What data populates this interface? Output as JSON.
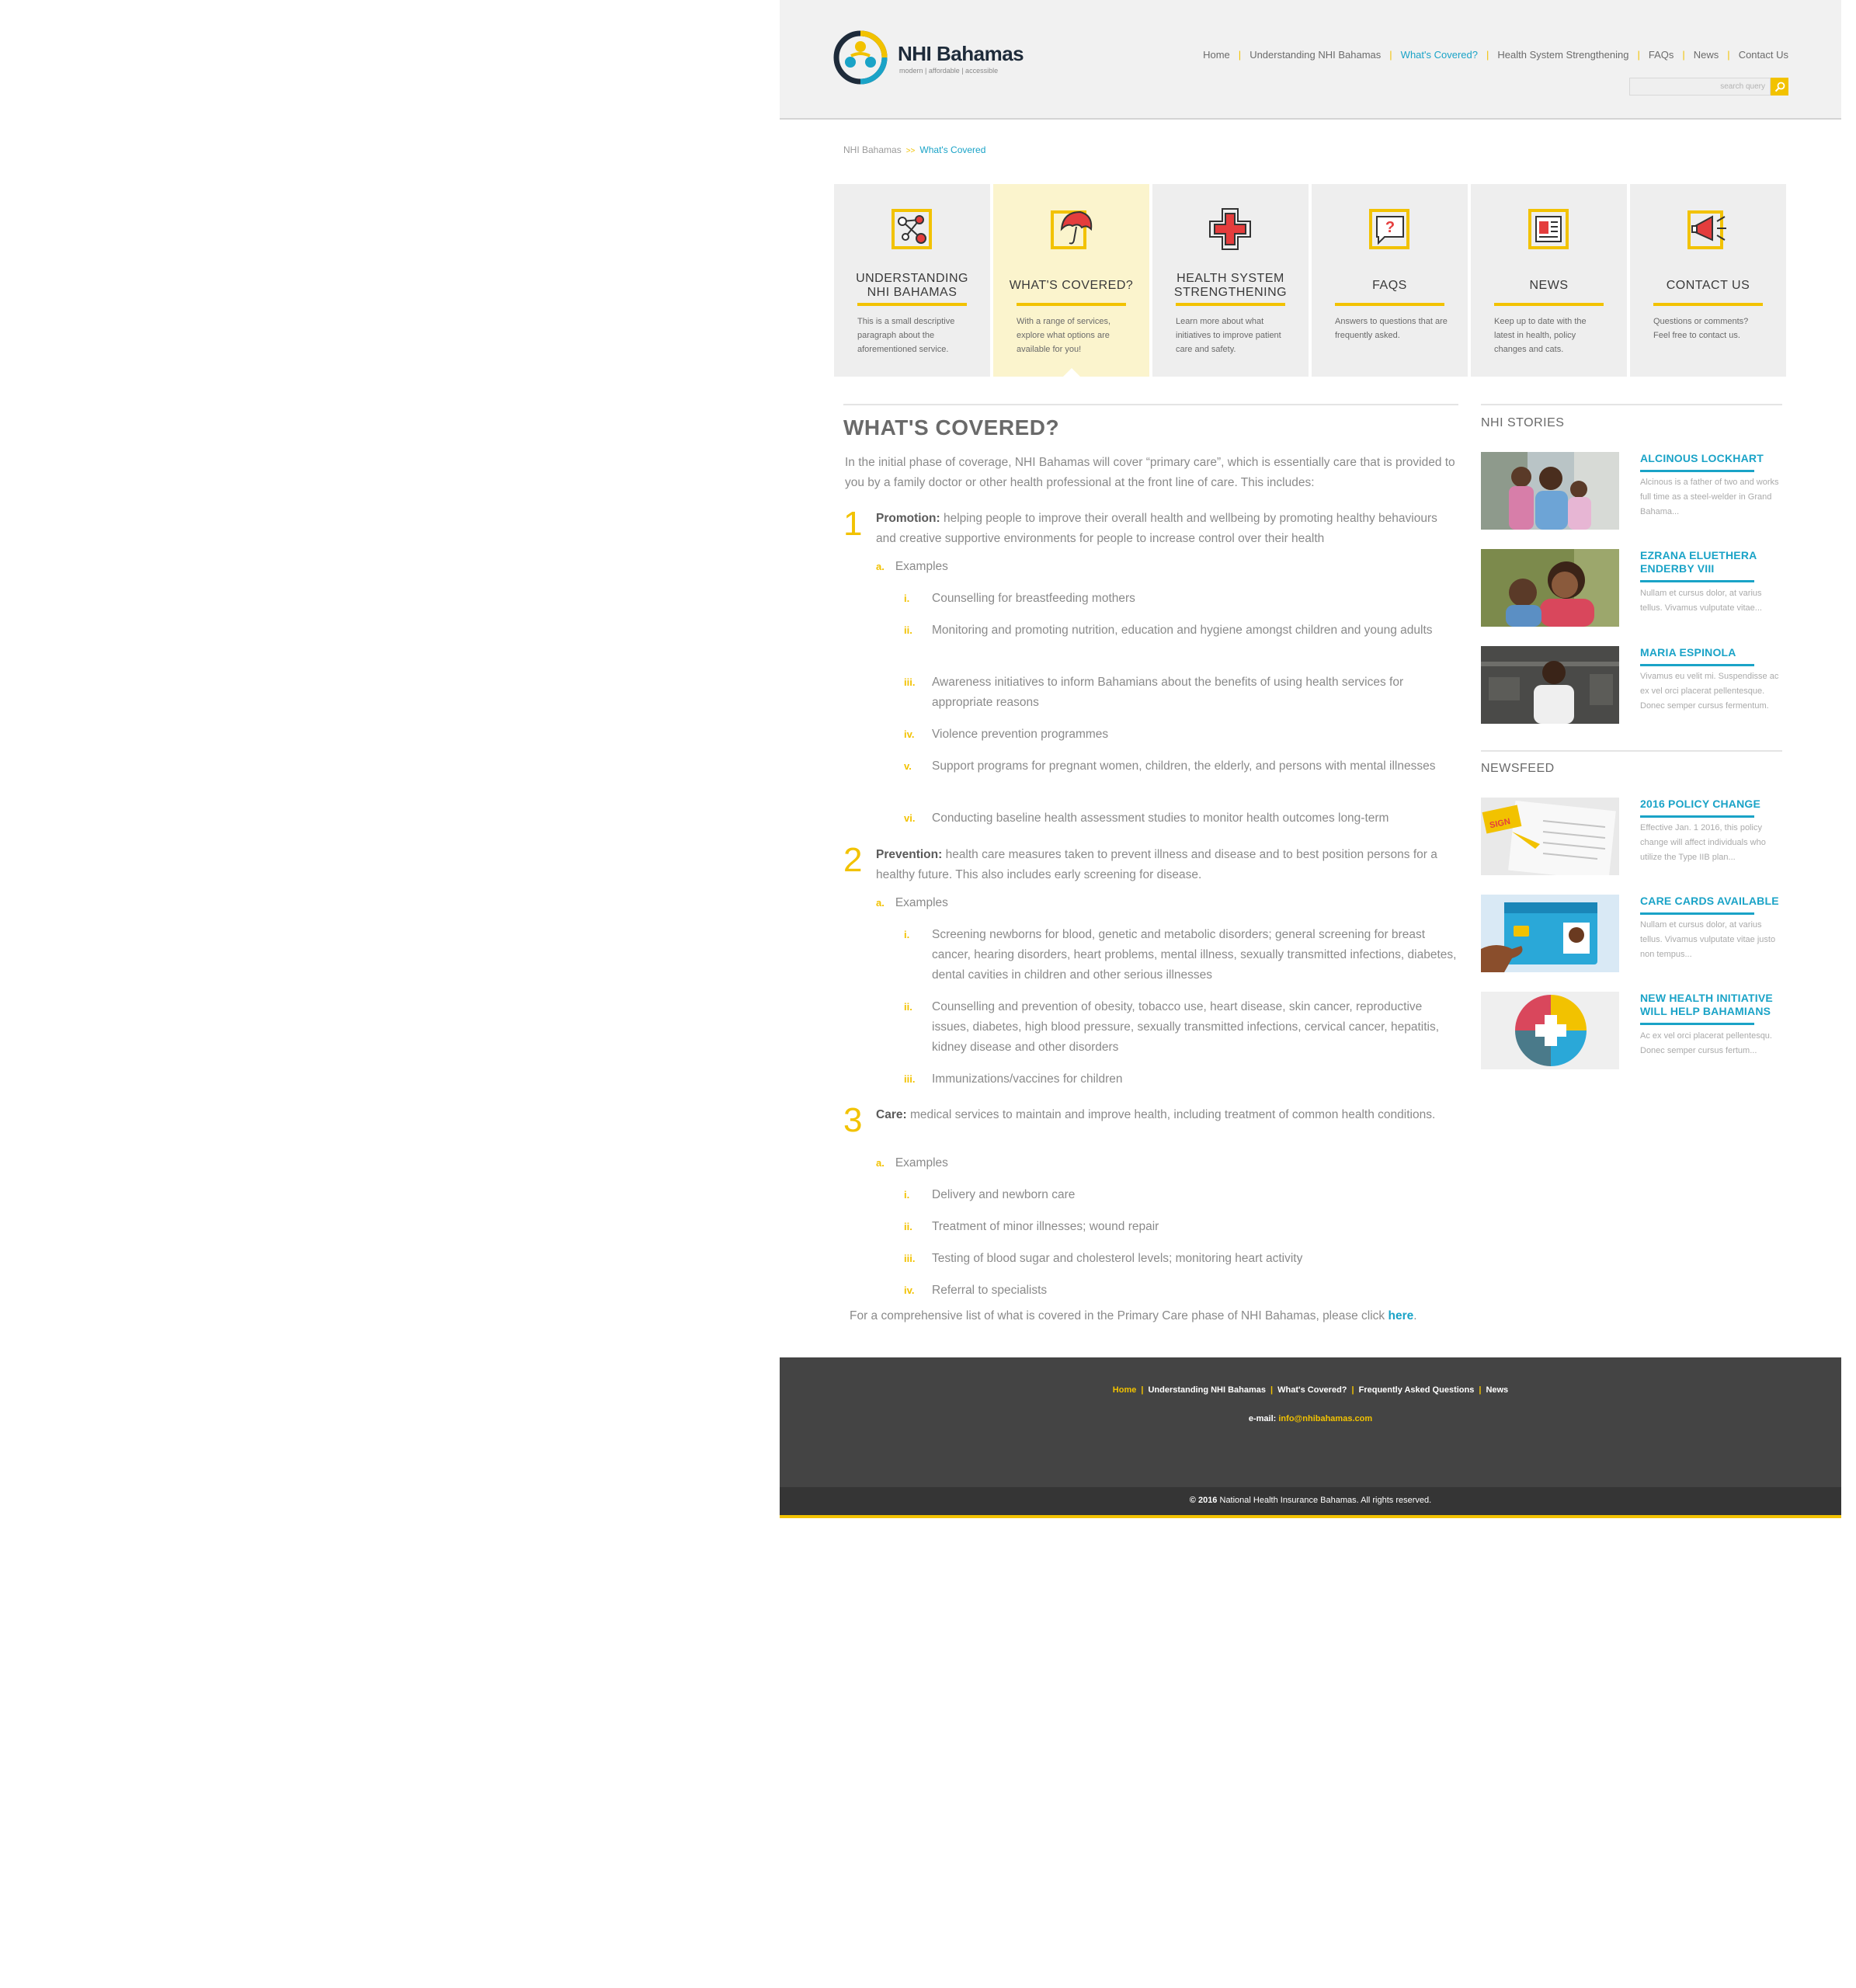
{
  "header": {
    "logo_name": "NHI Bahamas",
    "logo_tagline": "modern | affordable | accessible",
    "nav": [
      {
        "label": "Home",
        "active": false
      },
      {
        "label": "Understanding NHI Bahamas",
        "active": false
      },
      {
        "label": "What's Covered?",
        "active": true
      },
      {
        "label": "Health System Strengthening",
        "active": false
      },
      {
        "label": "FAQs",
        "active": false
      },
      {
        "label": "News",
        "active": false
      },
      {
        "label": "Contact Us",
        "active": false
      }
    ],
    "search_placeholder": "search query"
  },
  "breadcrumb": {
    "home": "NHI Bahamas",
    "separator": ">>",
    "current": "What's Covered"
  },
  "tiles": [
    {
      "title": "UNDERSTANDING NHI BAHAMAS",
      "desc": "This is a small descriptive paragraph about the aforementioned service.",
      "icon": "network-icon"
    },
    {
      "title": "WHAT'S COVERED?",
      "desc": "With a range of services, explore what options are available for you!",
      "icon": "umbrella-icon"
    },
    {
      "title": "HEALTH SYSTEM STRENGTHENING",
      "desc": "Learn more about what initiatives to improve patient care and safety.",
      "icon": "medical-cross-icon"
    },
    {
      "title": "FAQS",
      "desc": "Answers to questions that are frequently asked.",
      "icon": "question-bubble-icon"
    },
    {
      "title": "NEWS",
      "desc": "Keep up to date with the latest in health, policy changes and cats.",
      "icon": "newspaper-icon"
    },
    {
      "title": "CONTACT US",
      "desc": "Questions or comments? Feel free to contact us.",
      "icon": "megaphone-icon"
    }
  ],
  "main": {
    "title": "WHAT'S COVERED?",
    "intro": "In the initial phase of coverage, NHI Bahamas will cover “primary care”, which is essentially care that is provided to you by a family doctor or other health professional at the front line of care. This includes:",
    "sections": [
      {
        "number": "1",
        "term": "Promotion:",
        "text": " helping people to improve their overall health and wellbeing by promoting healthy behaviours and creative supportive environments for people to increase control over their health",
        "sub_label": "a.",
        "sub_text": "Examples",
        "items": [
          {
            "label": "i.",
            "text": "Counselling for breastfeeding mothers"
          },
          {
            "label": "ii.",
            "text": "Monitoring and promoting nutrition, education and hygiene amongst children and young adults"
          },
          {
            "label": "iii.",
            "text": "Awareness initiatives to inform Bahamians about the benefits of using health services for appropriate reasons"
          },
          {
            "label": "iv.",
            "text": "Violence prevention programmes"
          },
          {
            "label": "v.",
            "text": "Support programs for pregnant women, children, the elderly, and persons with mental illnesses"
          },
          {
            "label": "vi.",
            "text": "Conducting baseline health assessment studies to monitor health outcomes long-term"
          }
        ]
      },
      {
        "number": "2",
        "term": "Prevention:",
        "text": " health care measures taken to prevent illness and disease and to best position persons for a healthy future. This also includes early screening for disease.",
        "sub_label": "a.",
        "sub_text": "Examples",
        "items": [
          {
            "label": "i.",
            "text": "Screening newborns for blood, genetic and metabolic disorders; general screening for breast cancer, hearing disorders, heart problems, mental illness, sexually transmitted infections, diabetes, dental cavities in children and other serious illnesses"
          },
          {
            "label": "ii.",
            "text": "Counselling and prevention of obesity, tobacco use, heart disease, skin cancer, reproductive issues, diabetes, high blood pressure, sexually transmitted infections, cervical cancer, hepatitis, kidney disease and other disorders"
          },
          {
            "label": "iii.",
            "text": "Immunizations/vaccines for children"
          }
        ]
      },
      {
        "number": "3",
        "term": "Care:",
        "text": " medical services to maintain and improve health, including treatment of common health conditions.",
        "sub_label": "a.",
        "sub_text": "Examples",
        "items": [
          {
            "label": "i.",
            "text": "Delivery and newborn care"
          },
          {
            "label": "ii.",
            "text": "Treatment of minor illnesses; wound repair"
          },
          {
            "label": "iii.",
            "text": "Testing of blood sugar and cholesterol levels; monitoring heart activity"
          },
          {
            "label": "iv.",
            "text": "Referral to specialists"
          }
        ]
      }
    ],
    "closing_before": "For a comprehensive list of what is covered in the Primary Care phase of NHI Bahamas, please click ",
    "closing_link": "here",
    "closing_after": "."
  },
  "sidebar": {
    "stories_heading": "NHI STORIES",
    "stories": [
      {
        "title": "ALCINOUS LOCKHART",
        "text": "Alcinous is a father of two and works full time as a steel-welder in Grand Bahama..."
      },
      {
        "title": "EZRANA ELUETHERA ENDERBY VIII",
        "text": "Nullam et cursus dolor, at varius tellus. Vivamus vulputate vitae..."
      },
      {
        "title": "MARIA ESPINOLA",
        "text": "Vivamus eu velit mi. Suspendisse ac ex vel orci placerat pellentesque. Donec semper cursus fermentum."
      }
    ],
    "newsfeed_heading": "NEWSFEED",
    "news": [
      {
        "title": "2016 POLICY CHANGE",
        "text": "Effective Jan. 1 2016, this policy change will affect individuals who utilize the Type IIB plan..."
      },
      {
        "title": "CARE CARDS  AVAILABLE",
        "text": "Nullam et cursus dolor, at varius tellus. Vivamus vulputate vitae justo non tempus..."
      },
      {
        "title": "NEW HEALTH INITIATIVE WILL HELP BAHAMIANS",
        "text": "Ac ex vel orci placerat pellentesqu. Donec semper cursus fertum..."
      }
    ]
  },
  "footer": {
    "nav": [
      {
        "label": "Home",
        "active": true
      },
      {
        "label": "Understanding NHI Bahamas",
        "active": false
      },
      {
        "label": "What's Covered?",
        "active": false
      },
      {
        "label": "Frequently Asked Questions",
        "active": false
      },
      {
        "label": "News",
        "active": false
      }
    ],
    "email_label": "e-mail: ",
    "email": "info@nhibahamas.com",
    "copyright_year": "© 2016",
    "copyright_text": " National Health Insurance Bahamas. All rights reserved."
  },
  "colors": {
    "accent_yellow": "#f2c200",
    "accent_blue": "#1aa3c7",
    "footer_bg": "#444444",
    "header_bg": "#f1f1f1"
  }
}
